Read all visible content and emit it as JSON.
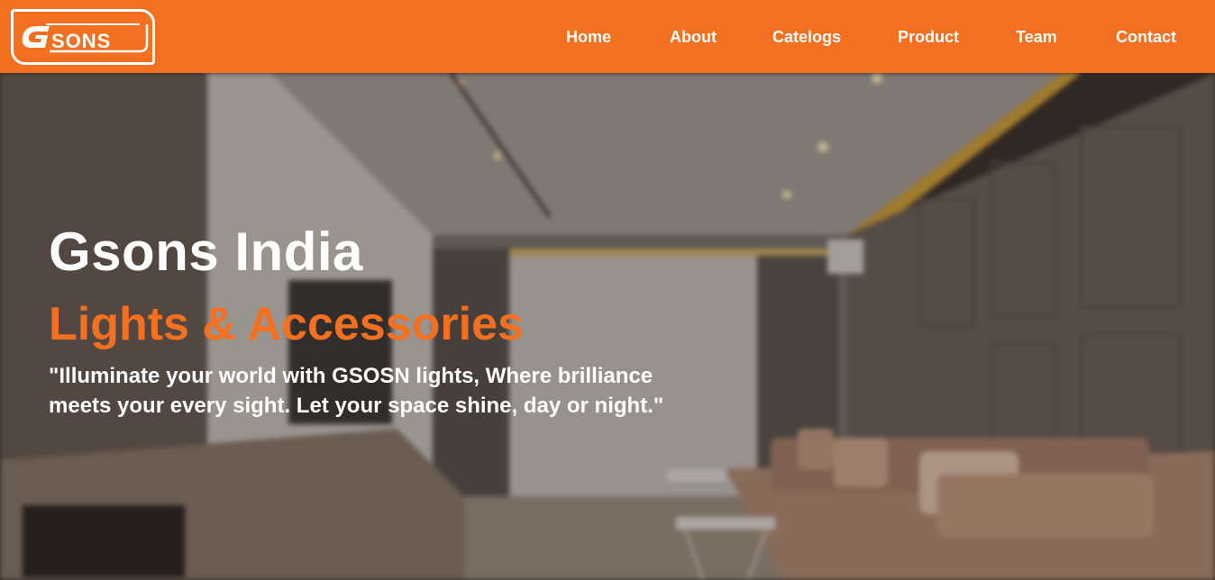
{
  "header": {
    "logo_text": "GSONS",
    "brand_color": "#f37021",
    "nav": [
      {
        "label": "Home"
      },
      {
        "label": "About"
      },
      {
        "label": "Catelogs"
      },
      {
        "label": "Product"
      },
      {
        "label": "Team"
      },
      {
        "label": "Contact"
      }
    ]
  },
  "hero": {
    "title": "Gsons India",
    "subtitle": "Lights & Accessories",
    "tagline": "\"Illuminate your world with GSOSN lights, Where brilliance meets your every sight. Let your space shine, day or night.\"",
    "background_image": "living-room-interior"
  }
}
